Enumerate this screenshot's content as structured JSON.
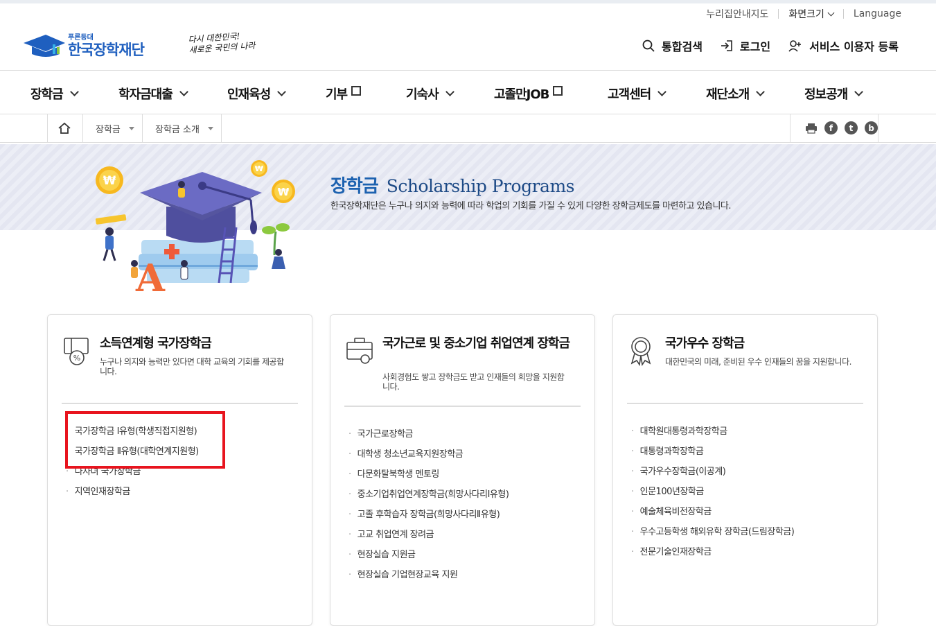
{
  "utility": {
    "sitemap": "누리집안내지도",
    "font_size": "화면크기",
    "language": "Language"
  },
  "logo": {
    "small": "푸른등대",
    "name": "한국장학재단"
  },
  "slogan": {
    "line1": "다시 대한민국!",
    "line2": "새로운 국민의 나라"
  },
  "actions": {
    "search": "통합검색",
    "login": "로그인",
    "register": "서비스 이용자 등록"
  },
  "gnb": [
    {
      "label": "장학금"
    },
    {
      "label": "학자금대출"
    },
    {
      "label": "인재육성"
    },
    {
      "label": "기부"
    },
    {
      "label": "기숙사"
    },
    {
      "label": "고졸만JOB"
    },
    {
      "label": "고객센터"
    },
    {
      "label": "재단소개"
    },
    {
      "label": "정보공개"
    }
  ],
  "breadcrumb": {
    "level1": "장학금",
    "level2": "장학금 소개"
  },
  "banner": {
    "title_ko": "장학금",
    "title_en": "Scholarship Programs",
    "desc": "한국장학재단은 누구나 의지와 능력에 따라 학업의 기회를 가질 수 있게 다양한 장학금제도를 마련하고 있습니다."
  },
  "cards": [
    {
      "title": "소득연계형 국가장학금",
      "desc": "누구나 의지와 능력만 있다면 대학 교육의 기회를 제공합니다.",
      "items": [
        "국가장학금 Ⅰ유형(학생직접지원형)",
        "국가장학금 Ⅱ유형(대학연계지원형)",
        "다자녀 국가장학금",
        "지역인재장학금"
      ]
    },
    {
      "title": "국가근로 및 중소기업 취업연계 장학금",
      "desc": "사회경험도 쌓고 장학금도 받고 인재들의 희망을 지원합니다.",
      "items": [
        "국가근로장학금",
        "대학생 청소년교육지원장학금",
        "다문화탈북학생 멘토링",
        "중소기업취업연계장학금(희망사다리Ⅰ유형)",
        "고졸 후학습자 장학금(희망사다리Ⅱ유형)",
        "고교 취업연계 장려금",
        "현장실습 지원금",
        "현장실습 기업현장교육 지원"
      ]
    },
    {
      "title": "국가우수 장학금",
      "desc": "대한민국의 미래, 준비된 우수 인재들의 꿈을 지원합니다.",
      "items": [
        "대학원대통령과학장학금",
        "대통령과학장학금",
        "국가우수장학금(이공계)",
        "인문100년장학금",
        "예술체육비전장학금",
        "우수고등학생 해외유학 장학금(드림장학금)",
        "전문기술인재장학금"
      ]
    }
  ],
  "illustration": {
    "coin_symbol": "₩",
    "letter": "A"
  },
  "colors": {
    "brand_blue": "#1f5fbf",
    "highlight_red": "#e8141e"
  }
}
